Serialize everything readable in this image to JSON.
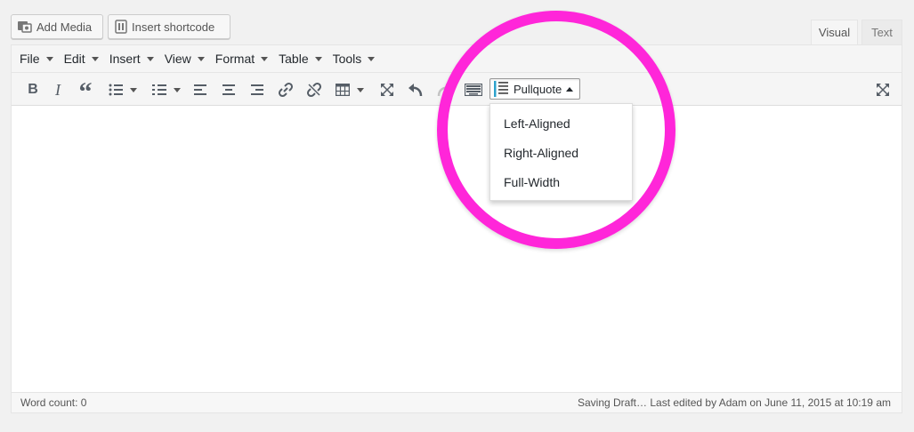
{
  "media_buttons": {
    "add_media": "Add Media",
    "insert_shortcode": "Insert shortcode"
  },
  "editor_tabs": {
    "visual": "Visual",
    "text": "Text"
  },
  "menubar": [
    "File",
    "Edit",
    "Insert",
    "View",
    "Format",
    "Table",
    "Tools"
  ],
  "toolbar_icons": [
    "bold-icon",
    "italic-icon",
    "blockquote-icon",
    "bullet-list-icon",
    "numbered-list-icon",
    "align-left-icon",
    "align-center-icon",
    "align-right-icon",
    "link-icon",
    "unlink-icon",
    "table-icon",
    "fullscreen-icon",
    "undo-icon",
    "redo-icon",
    "keyboard-icon",
    "pullquote-icon",
    "expand-icon"
  ],
  "toolbar": {
    "bold": "B",
    "italic": "I",
    "blockquote": "“"
  },
  "pullquote": {
    "label": "Pullquote",
    "options": [
      "Left-Aligned",
      "Right-Aligned",
      "Full-Width"
    ]
  },
  "status": {
    "word_count": "Word count: 0",
    "save_status": "Saving Draft… Last edited by Adam on June 11, 2015 at 10:19 am"
  },
  "highlight_color": "#ff26d9"
}
